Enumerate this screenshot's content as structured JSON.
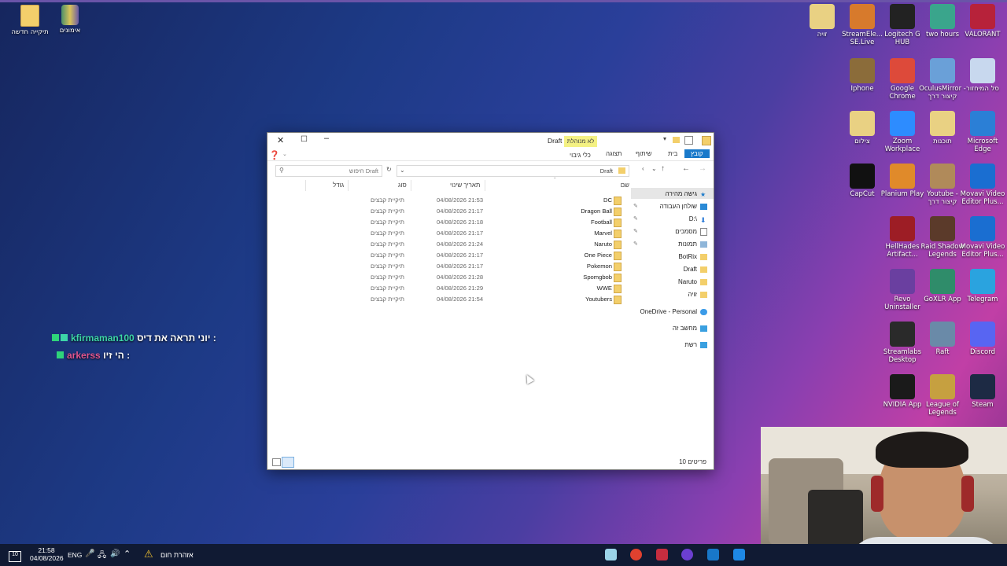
{
  "desktop": {
    "icons_left": [
      {
        "label": "תיקייה חדשה",
        "icon": "folder-icon"
      },
      {
        "label": "אימונים",
        "icon": "archive-icon"
      }
    ],
    "icons_right": [
      {
        "label": "VALORANT"
      },
      {
        "label": "two hours"
      },
      {
        "label": "Logitech G HUB"
      },
      {
        "label": "StreamEle... SE.Live"
      },
      {
        "label": "זויה"
      },
      {
        "label": "סל המיחזור"
      },
      {
        "label": "OculusMirror - קיצור דרך"
      },
      {
        "label": "Google Chrome"
      },
      {
        "label": "Iphone"
      },
      {
        "label": "Microsoft Edge"
      },
      {
        "label": "תוכנות"
      },
      {
        "label": "Zoom Workplace"
      },
      {
        "label": "צילום"
      },
      {
        "label": "Movavi Video Editor Plus..."
      },
      {
        "label": "Youtube - קיצור דרך"
      },
      {
        "label": "Planium Play"
      },
      {
        "label": "CapCut"
      },
      {
        "label": "Movavi Video Editor Plus..."
      },
      {
        "label": "Raid Shadow Legends"
      },
      {
        "label": "HellHades Artifact..."
      },
      {
        "label": "Telegram"
      },
      {
        "label": "GoXLR App"
      },
      {
        "label": "Revo Uninstaller"
      },
      {
        "label": "Discord"
      },
      {
        "label": "Raft"
      },
      {
        "label": "Streamlabs Desktop"
      },
      {
        "label": "Steam"
      },
      {
        "label": "League of Legends"
      },
      {
        "label": "NVIDIA App"
      }
    ]
  },
  "explorer": {
    "title": "Draft",
    "manage_label": "לא מנוהלת",
    "tools_label": "כלי גיבוי",
    "ribbon_tabs": [
      "קובץ",
      "בית",
      "שיתוף",
      "תצוגה"
    ],
    "address": "Draft",
    "search_placeholder": "חיפוש Draft",
    "columns": {
      "name": "שם",
      "date": "תאריך שינוי",
      "type": "סוג",
      "size": "גודל"
    },
    "nav": [
      {
        "label": "גישה מהירה"
      },
      {
        "label": "שולחן העבודה"
      },
      {
        "label": "D:\\"
      },
      {
        "label": "מסמכים"
      },
      {
        "label": "תמונות"
      },
      {
        "label": "BotRix"
      },
      {
        "label": "Draft"
      },
      {
        "label": "Naruto"
      },
      {
        "label": "זויה"
      },
      {
        "label": "OneDrive - Personal"
      },
      {
        "label": "מחשב זה"
      },
      {
        "label": "רשת"
      }
    ],
    "files": [
      {
        "name": "DC",
        "date": "04/08/2026 21:53",
        "type": "תיקיית קבצים"
      },
      {
        "name": "Dragon Ball",
        "date": "04/08/2026 21:17",
        "type": "תיקיית קבצים"
      },
      {
        "name": "Football",
        "date": "04/08/2026 21:18",
        "type": "תיקיית קבצים"
      },
      {
        "name": "Marvel",
        "date": "04/08/2026 21:17",
        "type": "תיקיית קבצים"
      },
      {
        "name": "Naruto",
        "date": "04/08/2026 21:24",
        "type": "תיקיית קבצים"
      },
      {
        "name": "One Piece",
        "date": "04/08/2026 21:17",
        "type": "תיקיית קבצים"
      },
      {
        "name": "Pokemon",
        "date": "04/08/2026 21:17",
        "type": "תיקיית קבצים"
      },
      {
        "name": "Spomgbob",
        "date": "04/08/2026 21:28",
        "type": "תיקיית קבצים"
      },
      {
        "name": "WWE",
        "date": "04/08/2026 21:29",
        "type": "תיקיית קבצים"
      },
      {
        "name": "Youtubers",
        "date": "04/08/2026 21:54",
        "type": "תיקיית קבצים"
      }
    ],
    "status_count": "10 פריטים"
  },
  "chat": [
    {
      "user": "kfirmaman100",
      "message": "יוני תראה את דיס :",
      "color": "#3dd6a8"
    },
    {
      "user": "arkerss",
      "message": "הי זיו :",
      "color": "#e0568f"
    }
  ],
  "taskbar": {
    "time": "21:58",
    "date": "04/08/2026",
    "lang": "ENG",
    "notification_count": "10",
    "weather_alert": "אזהרת חום"
  }
}
